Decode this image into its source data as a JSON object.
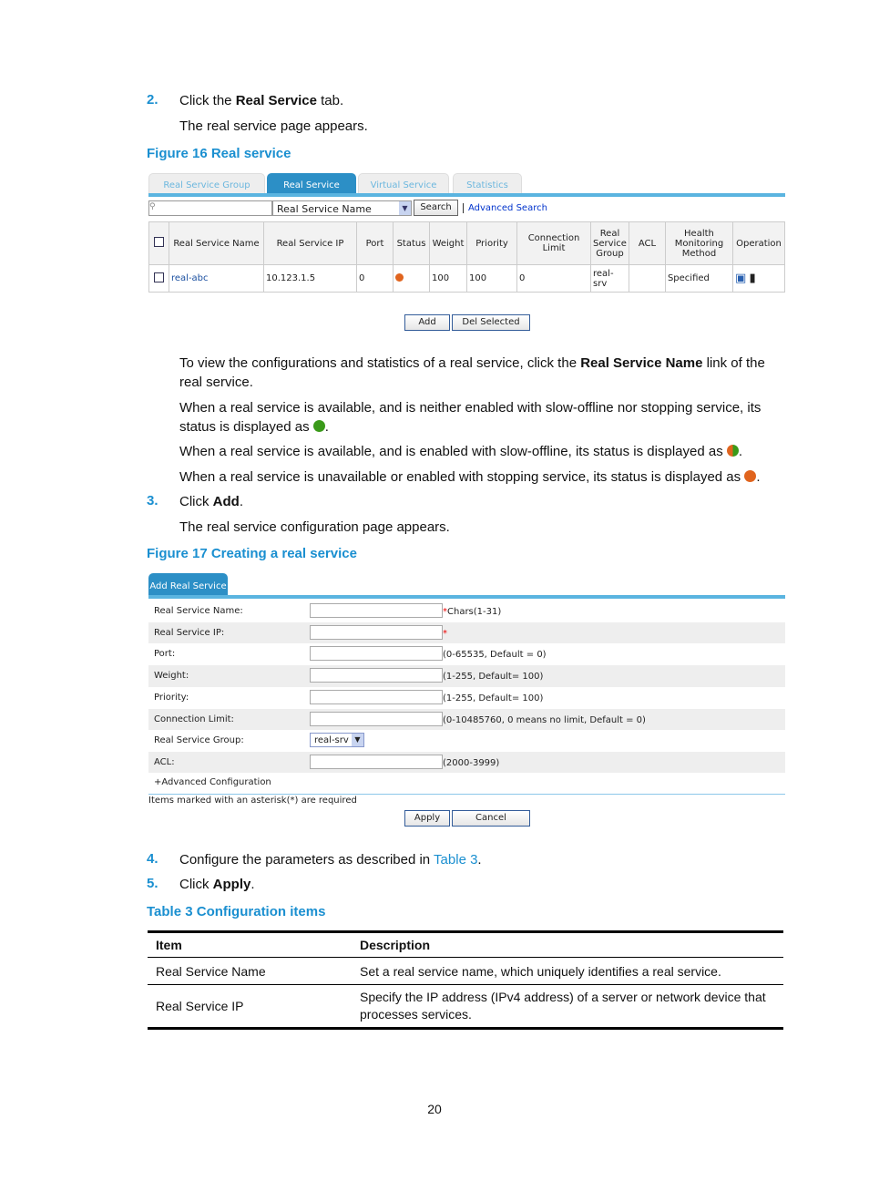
{
  "steps": {
    "s2": {
      "num": "2.",
      "pre": "Click the ",
      "bold": "Real Service",
      "post": " tab.",
      "sub": "The real service page appears."
    },
    "s3": {
      "num": "3.",
      "pre": "Click ",
      "bold": "Add",
      "post": ".",
      "sub": "The real service configuration page appears."
    },
    "s4": {
      "num": "4.",
      "pre": "Configure the parameters as described in ",
      "link": "Table 3",
      "post": "."
    },
    "s5": {
      "num": "5.",
      "pre": "Click ",
      "bold": "Apply",
      "post": "."
    }
  },
  "fig16": {
    "caption": "Figure 16 Real service",
    "tabs": [
      "Real Service Group",
      "Real Service",
      "Virtual Service",
      "Statistics"
    ],
    "search": {
      "value": "",
      "field": "Real Service Name",
      "button": "Search",
      "advanced": "Advanced Search"
    },
    "headers": [
      "Real Service Name",
      "Real Service IP",
      "Port",
      "Status",
      "Weight",
      "Priority",
      "Connection Limit",
      "Real Service Group",
      "ACL",
      "Health Monitoring Method",
      "Operation"
    ],
    "row": {
      "name": "real-abc",
      "ip": "10.123.1.5",
      "port": "0",
      "status": "unavailable",
      "weight": "100",
      "priority": "100",
      "conn": "0",
      "group": "real-srv",
      "acl": "",
      "health": "Specified"
    },
    "buttons": {
      "add": "Add",
      "del": "Del Selected"
    }
  },
  "paras": {
    "p1a": "To view the configurations and statistics of a real service, click the ",
    "p1b": "Real Service Name",
    "p1c": " link of the real service.",
    "p2": "When a real service is available, and is neither enabled with slow-offline nor stopping service, its status is displayed as ",
    "p3": "When a real service is available, and is enabled with slow-offline, its status is displayed as ",
    "p4": "When a real service is unavailable or enabled with stopping service, its status is displayed as ",
    "end": "."
  },
  "status_colors": {
    "available": "#3a9a1a",
    "slow_offline": "#e0641e",
    "unavailable": "#e0641e"
  },
  "fig17": {
    "caption": "Figure 17 Creating a real service",
    "tab": "Add Real Service",
    "fields": [
      {
        "label": "Real Service Name:",
        "value": "",
        "req": "*",
        "hint": "Chars(1-31)"
      },
      {
        "label": "Real Service IP:",
        "value": "",
        "req": "*",
        "hint": ""
      },
      {
        "label": "Port:",
        "value": "",
        "req": "",
        "hint": "(0-65535, Default = 0)"
      },
      {
        "label": "Weight:",
        "value": "",
        "req": "",
        "hint": "(1-255, Default= 100)"
      },
      {
        "label": "Priority:",
        "value": "",
        "req": "",
        "hint": "(1-255, Default= 100)"
      },
      {
        "label": "Connection Limit:",
        "value": "",
        "req": "",
        "hint": "(0-10485760, 0 means no limit, Default = 0)"
      },
      {
        "label": "Real Service Group:",
        "value": "real-srv",
        "req": "",
        "hint": ""
      },
      {
        "label": "ACL:",
        "value": "",
        "req": "",
        "hint": "(2000-3999)"
      }
    ],
    "advanced": "+Advanced Configuration",
    "note": "Items marked with an asterisk(*) are required",
    "apply": "Apply",
    "cancel": "Cancel"
  },
  "table3": {
    "caption": "Table 3 Configuration items",
    "headers": [
      "Item",
      "Description"
    ],
    "rows": [
      [
        "Real Service Name",
        "Set a real service name, which uniquely identifies a real service."
      ],
      [
        "Real Service IP",
        "Specify the IP address (IPv4 address) of a server or network device that processes services."
      ]
    ]
  },
  "page_number": "20"
}
